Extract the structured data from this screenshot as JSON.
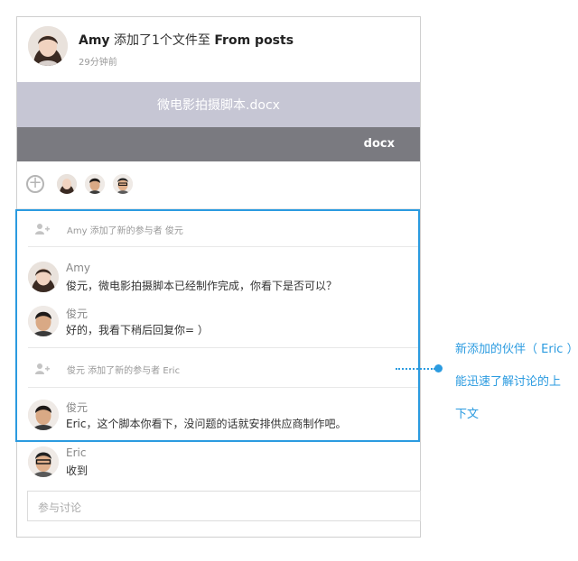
{
  "header": {
    "user": "Amy",
    "action": "添加了1个文件至",
    "target": "From posts",
    "time": "29分钟前"
  },
  "file": {
    "name": "微电影拍摄脚本.docx",
    "type": "docx"
  },
  "participants": {
    "add_symbol": "+",
    "avatars": [
      "amy",
      "junyuan",
      "eric"
    ]
  },
  "timeline": [
    {
      "kind": "system",
      "text": "Amy 添加了新的参与者 俊元"
    },
    {
      "kind": "message",
      "name": "Amy",
      "text": "俊元，微电影拍摄脚本已经制作完成，你看下是否可以？"
    },
    {
      "kind": "message",
      "name": "俊元",
      "text": "好的，我看下稍后回复你= ）"
    },
    {
      "kind": "system",
      "text": "俊元  添加了新的参与者  Eric"
    },
    {
      "kind": "message",
      "name": "俊元",
      "text": "Eric，这个脚本你看下，没问题的话就安排供应商制作吧。"
    },
    {
      "kind": "message",
      "name": "Eric",
      "text": "收到"
    }
  ],
  "reply": {
    "placeholder": "参与讨论"
  },
  "annotation": {
    "lines": [
      "新添加的伙伴（ Eric ）",
      "能迅速了解讨论的上",
      "下文"
    ],
    "color": "#2b9be0"
  }
}
